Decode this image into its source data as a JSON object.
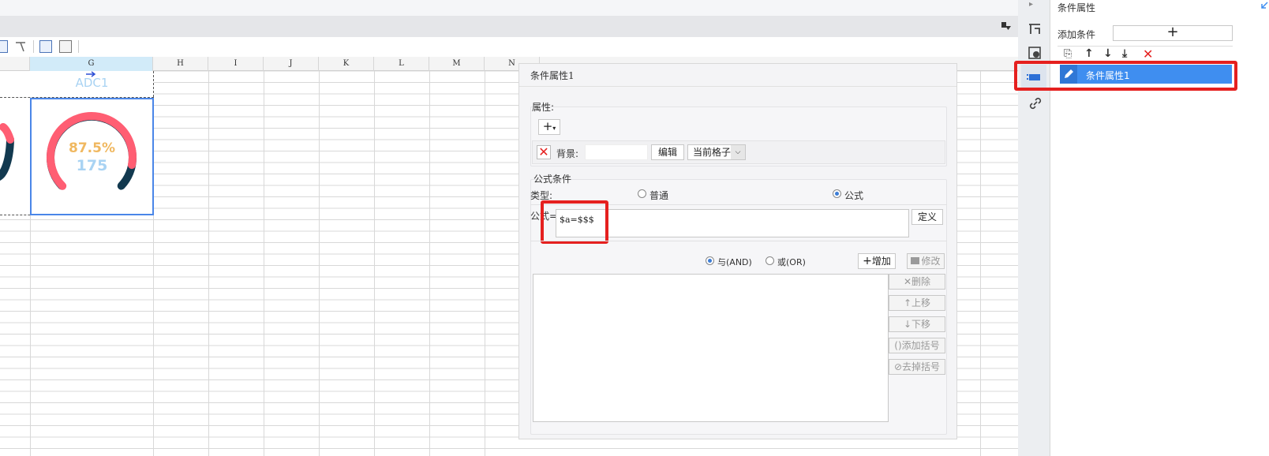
{
  "sheet": {
    "columns": [
      "G",
      "H",
      "I",
      "J",
      "K",
      "L",
      "M",
      "N"
    ],
    "cell_title": "ADC1",
    "gauge": {
      "percent_text": "87.5%",
      "value_text": "175",
      "fill_fraction": 0.875,
      "colors": {
        "arc": "#ff5e73",
        "track": "#12394f"
      }
    }
  },
  "dialog": {
    "title": "条件属性1",
    "attributes": {
      "section_label": "属性:",
      "add_symbol": "+",
      "bg_label": "背景:",
      "edit_button": "编辑",
      "scope_select": "当前格子"
    },
    "formula_condition": {
      "section_label": "公式条件",
      "type_label": "类型:",
      "option_normal": "普通",
      "option_formula": "公式",
      "selected": "公式",
      "formula_label": "公式=",
      "formula_value": "$a=$$$",
      "define_button": "定义",
      "and_label": "与(AND)",
      "or_label": "或(OR)",
      "add_button": "增加",
      "modify_button": "修改",
      "delete_button": "删除",
      "up_button": "上移",
      "down_button": "下移",
      "add_bracket_button": "添加括号",
      "remove_bracket_button": "去掉括号"
    }
  },
  "panel": {
    "title": "条件属性",
    "add_condition_label": "添加条件",
    "add_symbol": "+",
    "items": [
      {
        "label": "条件属性1"
      }
    ]
  },
  "colors": {
    "highlight": "#e5201f",
    "accent": "#3f8ef0"
  }
}
